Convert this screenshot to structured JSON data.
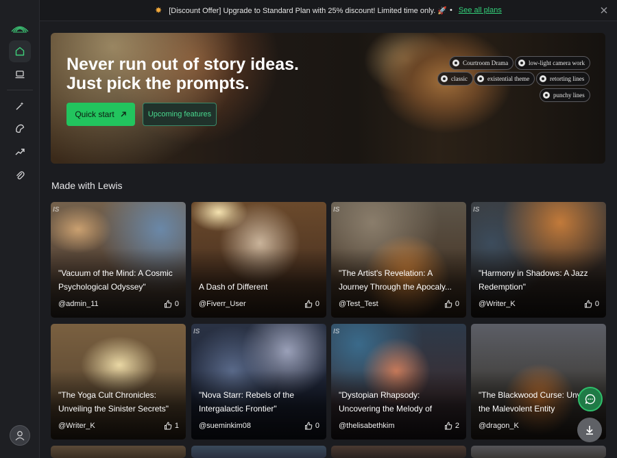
{
  "promo": {
    "icon": "sparkle-icon",
    "text": "[Discount Offer] Upgrade to Standard Plan with 25% discount! Limited time only. 🚀",
    "separator": "•",
    "link_label": "See all plans"
  },
  "hero": {
    "title_line1": "Never run out of story ideas.",
    "title_line2": "Just pick the prompts.",
    "quick_start_label": "Quick start",
    "upcoming_label": "Upcoming features",
    "chips": [
      "Courtroom Drama",
      "low-light camera work",
      "classic",
      "existential theme",
      "retorting lines",
      "punchy lines"
    ]
  },
  "section": {
    "title": "Made with Lewis"
  },
  "cards": [
    {
      "title": "\"Vacuum of the Mind: A Cosmic Psychological Odyssey\"",
      "author": "@admin_11",
      "likes": "0",
      "watermark": "IS"
    },
    {
      "title": "A Dash of Different",
      "author": "@Fiverr_User",
      "likes": "0",
      "watermark": ""
    },
    {
      "title": "\"The Artist's Revelation: A Journey Through the Apocaly...",
      "author": "@Test_Test",
      "likes": "0",
      "watermark": "IS"
    },
    {
      "title": "\"Harmony in Shadows: A Jazz Redemption\"",
      "author": "@Writer_K",
      "likes": "0",
      "watermark": "IS"
    },
    {
      "title": "\"The Yoga Cult Chronicles: Unveiling the Sinister Secrets\"",
      "author": "@Writer_K",
      "likes": "1",
      "watermark": ""
    },
    {
      "title": "\"Nova Starr: Rebels of the Intergalactic Frontier\"",
      "author": "@sueminkim08",
      "likes": "0",
      "watermark": "IS"
    },
    {
      "title": "\"Dystopian Rhapsody: Uncovering the Melody of Betraya...",
      "author": "@thelisabethkim",
      "likes": "2",
      "watermark": "IS"
    },
    {
      "title": "\"The Blackwood Curse: Unveiling the Malevolent Entity",
      "author": "@dragon_K",
      "likes": "",
      "watermark": ""
    }
  ],
  "accent": "#22c45e"
}
